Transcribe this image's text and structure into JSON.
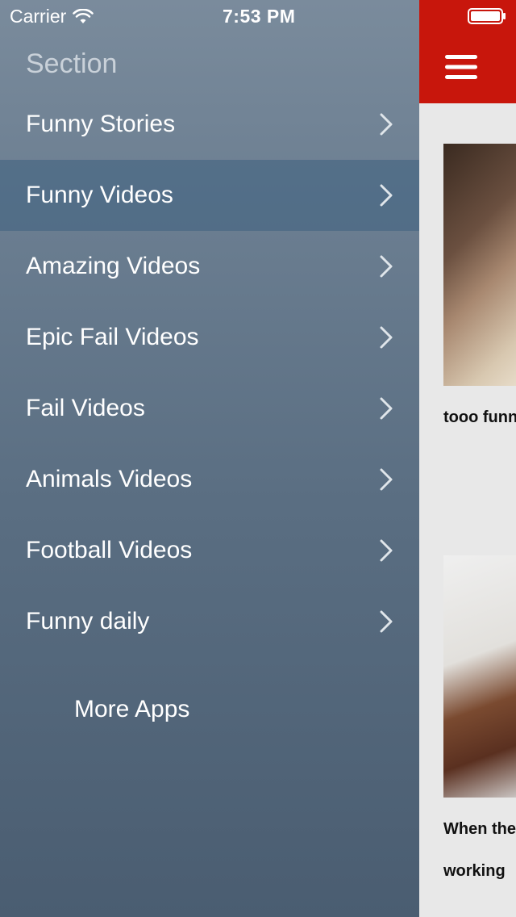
{
  "status_bar": {
    "carrier": "Carrier",
    "time": "7:53 PM"
  },
  "menu": {
    "section_title": "Section",
    "items": [
      {
        "label": "Funny Stories",
        "active": false
      },
      {
        "label": "Funny Videos",
        "active": true
      },
      {
        "label": "Amazing Videos",
        "active": false
      },
      {
        "label": "Epic Fail Videos",
        "active": false
      },
      {
        "label": "Fail Videos",
        "active": false
      },
      {
        "label": "Animals Videos",
        "active": false
      },
      {
        "label": "Football Videos",
        "active": false
      },
      {
        "label": "Funny daily",
        "active": false
      }
    ],
    "more_apps": "More Apps"
  },
  "content": {
    "cards": [
      {
        "title_lines": [
          "tooo funn"
        ]
      },
      {
        "title_lines": [
          "When the",
          "working"
        ]
      }
    ]
  },
  "colors": {
    "navbar": "#c8160c",
    "menu_active": "#4e6d8a",
    "content_bg": "#e8e8e8"
  },
  "icons": {
    "wifi": "wifi-icon",
    "battery": "battery-icon",
    "chevron": "chevron-right-icon",
    "menu": "hamburger-icon"
  }
}
